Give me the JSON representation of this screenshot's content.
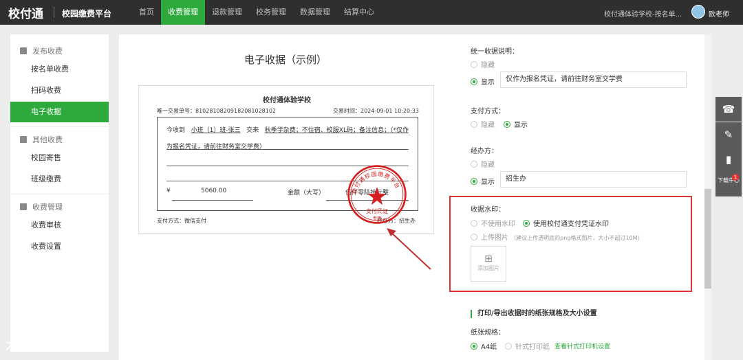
{
  "header": {
    "logo": "校付通",
    "platform": "校园缴费平台",
    "nav": [
      "首页",
      "收费管理",
      "退款管理",
      "校务管理",
      "数据管理",
      "结算中心"
    ],
    "active_nav": 1,
    "school": "校付通体验学校-按名单...",
    "user": "欧老师"
  },
  "sidebar": {
    "groups": [
      {
        "title": "发布收费",
        "items": [
          "按名单收费",
          "扫码收费",
          "电子收据"
        ]
      },
      {
        "title": "其他收费",
        "items": [
          "校园寄售",
          "班级缴费"
        ]
      },
      {
        "title": "收费管理",
        "items": [
          "收费审核",
          "收费设置"
        ]
      }
    ],
    "active": "电子收据"
  },
  "receipt": {
    "title": "电子收据（示例）",
    "school": "校付通体验学校",
    "trade_no": "唯一交易单号：8102810820918208102810​2",
    "trade_time": "交易时间：2024-09-01 10:20:33",
    "line1_a": "今收到",
    "line1_b": "小班（1）班-张三",
    "line1_c": "交来",
    "line1_d": "秋季学杂费；不住宿、校服XL码；备注信息；（*仅作",
    "line2": "为报名凭证，请前往财务室交学费）",
    "yen": "¥",
    "amount": "5060.00",
    "cap_label": "金额（大写）",
    "cap_value": "伍仟零陆拾元整",
    "payment": "支付方式：微信支付",
    "operator": "经办方：招生办",
    "stamp_text_top": "校付通校园缴费平台",
    "stamp_text_bottom": "支付凭证",
    "stamp_text_sub": "专用"
  },
  "settings": {
    "note": {
      "label": "统一收据说明：",
      "hide": "隐藏",
      "show": "显示",
      "value": "仅作为报名凭证，请前往财务室交学费"
    },
    "pay": {
      "label": "支付方式：",
      "hide": "隐藏",
      "show": "显示"
    },
    "op": {
      "label": "经办方：",
      "hide": "隐藏",
      "show": "显示",
      "value": "招生办"
    },
    "wm": {
      "label": "收据水印：",
      "none": "不使用水印",
      "use": "使用校付通支付凭证水印",
      "upload": "上传图片",
      "hint": "（建议上传透明底的png格式图片，大小不超过10M）",
      "add": "添加图片"
    },
    "print": {
      "title": "打印/导出收据时的纸张规格及大小设置",
      "paper_label": "纸张规格：",
      "a4": "A4纸",
      "dot": "针式打印纸",
      "link": "查看针式打印机设置"
    }
  },
  "right_tools": {
    "download": "下载中心",
    "badge": "1"
  },
  "watermark": "大数跨境",
  "colors": {
    "accent": "#2eaa3c",
    "highlight": "#dd3333",
    "stamp": "#d42020"
  }
}
